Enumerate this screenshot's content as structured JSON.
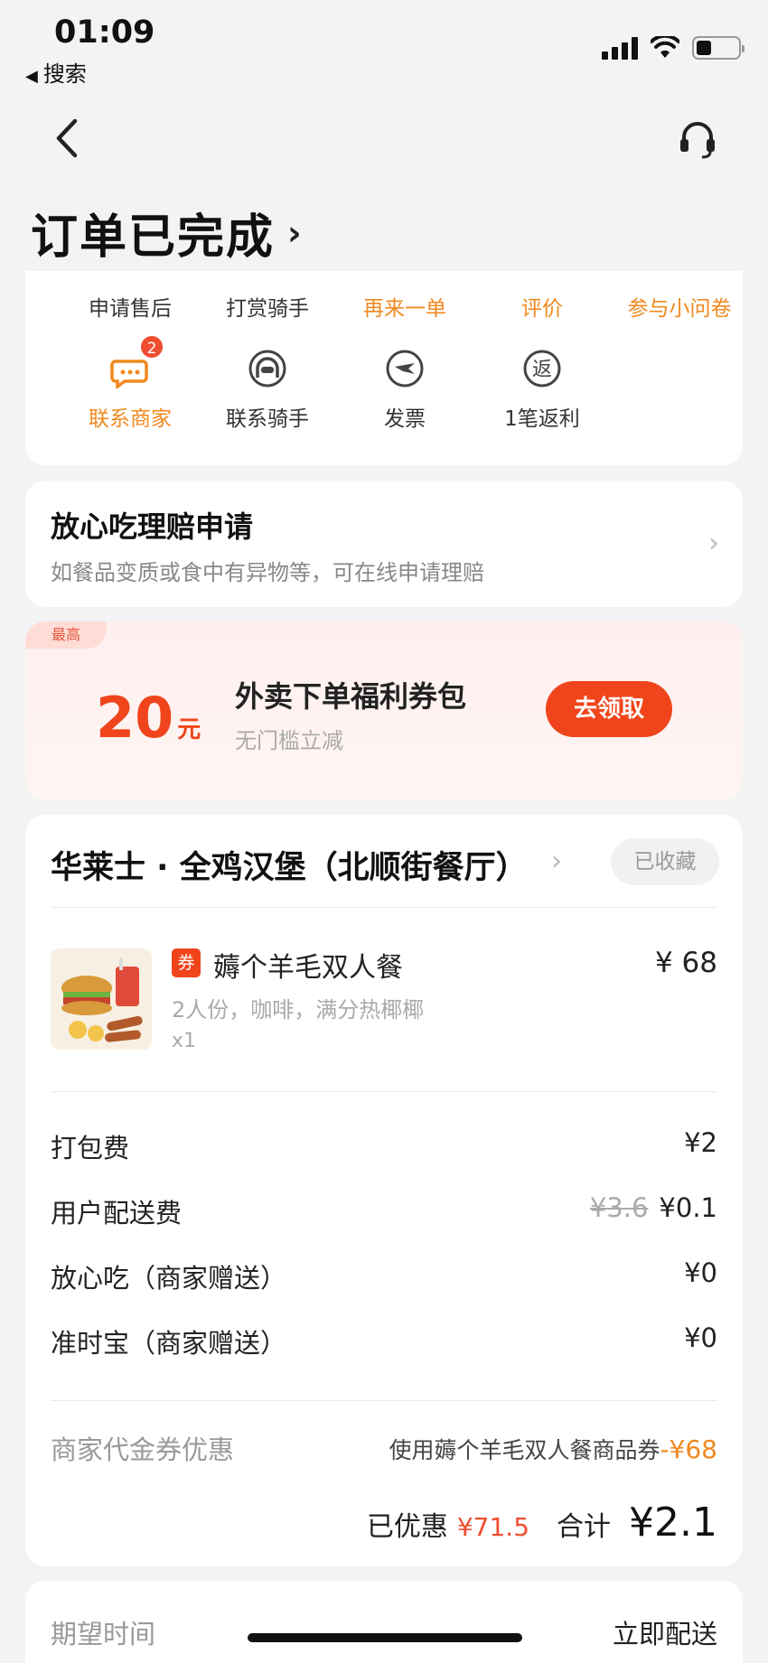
{
  "status_bar": {
    "time": "01:09",
    "back_app": "搜索",
    "back_arrow": "◀"
  },
  "header": {
    "title": "订单已完成",
    "title_chevron": "›"
  },
  "actions": [
    {
      "label": "申请售后",
      "color": "#333333"
    },
    {
      "label": "打赏骑手",
      "color": "#333333"
    },
    {
      "label": "再来一单",
      "color": "#f0891f"
    },
    {
      "label": "评价",
      "color": "#f0891f"
    },
    {
      "label": "参与小问卷",
      "color": "#f0891f"
    }
  ],
  "icon_actions": [
    {
      "label": "联系商家",
      "icon": "merchant-chat-icon",
      "badge": "2"
    },
    {
      "label": "联系骑手",
      "icon": "rider-helmet-icon"
    },
    {
      "label": "发票",
      "icon": "invoice-icon"
    },
    {
      "label": "1笔返利",
      "icon": "rebate-icon",
      "icon_text": "返"
    }
  ],
  "claim": {
    "title": "放心吃理赔申请",
    "subtitle": "如餐品变质或食中有异物等，可在线申请理赔",
    "chevron": "›"
  },
  "coupon_promo": {
    "tag": "最高",
    "amount": "20",
    "unit": "元",
    "title": "外卖下单福利券包",
    "subtitle": "无门槛立减",
    "button": "去领取"
  },
  "order": {
    "store_name": "华莱士 · 全鸡汉堡（北顺街餐厅）",
    "store_chevron": "›",
    "favorite_label": "已收藏",
    "item": {
      "coupon_tag": "券",
      "name": "薅个羊毛双人餐",
      "desc": "2人份，咖啡，满分热椰椰",
      "qty": "x1",
      "price": "¥ 68"
    },
    "fees": [
      {
        "name": "打包费",
        "value": "¥2",
        "original": ""
      },
      {
        "name": "用户配送费",
        "value": "¥0.1",
        "original": "¥3.6"
      },
      {
        "name": "放心吃（商家赠送）",
        "value": "¥0",
        "original": ""
      },
      {
        "name": "准时宝（商家赠送）",
        "value": "¥0",
        "original": ""
      }
    ],
    "voucher": {
      "name": "商家代金券优惠",
      "desc": "使用薅个羊毛双人餐商品券",
      "amount": "-¥68"
    },
    "total": {
      "discount_label": "已优惠",
      "discount_value": "¥71.5",
      "total_label": "合计",
      "total_value": "¥2.1"
    }
  },
  "delivery": {
    "label": "期望时间",
    "value": "立即配送"
  }
}
